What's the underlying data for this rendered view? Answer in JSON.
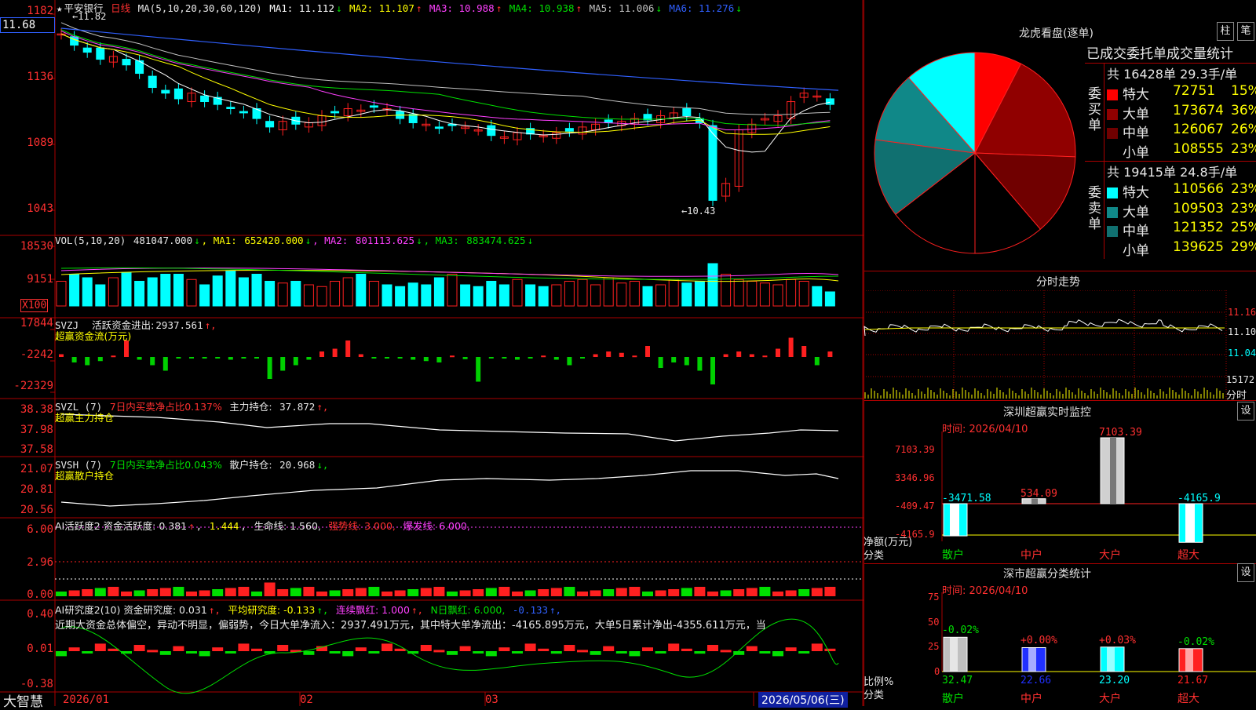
{
  "stock": {
    "name": "平安银行",
    "period": "日线",
    "current_price_tag": "11.68"
  },
  "kline": {
    "ma_header": "MA(5,10,20,30,60,120)",
    "ma_values": [
      {
        "label": "MA1:",
        "value": "11.112",
        "arrow": "↓",
        "color": "#ffffff"
      },
      {
        "label": "MA2:",
        "value": "11.107",
        "arrow": "↑",
        "color": "#ffff00"
      },
      {
        "label": "MA3:",
        "value": "10.988",
        "arrow": "↑",
        "color": "#ff40ff"
      },
      {
        "label": "MA4:",
        "value": "10.938",
        "arrow": "↑",
        "color": "#00e000"
      },
      {
        "label": "MA5:",
        "value": "11.006",
        "arrow": "↓",
        "color": "#c0c0c0"
      },
      {
        "label": "MA6:",
        "value": "11.276",
        "arrow": "↓",
        "color": "#3060ff"
      }
    ],
    "y_labels": [
      "1182",
      "1136",
      "1089",
      "1043"
    ],
    "high_note": "11.82",
    "low_note": "10.43"
  },
  "volume": {
    "header": "VOL(5,10,20)",
    "value": "481047.000",
    "ma1": "652420.000",
    "ma2": "801113.625",
    "ma3": "883474.625",
    "y_labels": [
      "18530",
      "9151"
    ],
    "unit": "X100"
  },
  "svzj": {
    "name": "SVZJ",
    "label": "活跃资金进出:",
    "value": "2937.561",
    "sub": "超赢资金流(万元)",
    "y_labels": [
      "17844",
      "-2242",
      "-22329"
    ]
  },
  "svzl": {
    "name": "SVZL (7)",
    "ratio_label": "7日内买卖净占比0.137%",
    "hold_label": "主力持仓:",
    "hold_value": "37.872",
    "sub": "超赢主力持仓",
    "y_labels": [
      "38.38",
      "37.98",
      "37.58"
    ]
  },
  "svsh": {
    "name": "SVSH (7)",
    "ratio_label": "7日内买卖净占比0.043%",
    "hold_label": "散户持仓:",
    "hold_value": "20.968",
    "sub": "超赢散户持仓",
    "y_labels": [
      "21.07",
      "20.81",
      "20.56"
    ]
  },
  "ai_active": {
    "header": "AI活跃度2 资金活跃度: 0.381",
    "v2": "1.444",
    "life": "生命线: 1.560,",
    "strong": "强势线: 3.000,",
    "burst": "爆发线: 6.000,",
    "y_labels": [
      "6.00",
      "2.96",
      "0.00"
    ]
  },
  "ai_research": {
    "header": "AI研究度2(10) 资金研究度: 0.031",
    "avg": "平均研究度: -0.133",
    "streak": "连续飘红: 1.000",
    "nday": "N日飘红: 6.000,",
    "last": "-0.133",
    "comment": "近期大资金总体偏空，异动不明显，偏弱势，今日大单净流入：2937.491万元，其中特大单净流出：-4165.895万元，大单5日累计净出-4355.611万元，当",
    "y_labels": [
      "0.40",
      "0.01",
      "-0.38"
    ]
  },
  "bottom_axis": {
    "brand": "大智慧",
    "labels": [
      "2026/01",
      "02",
      "03"
    ],
    "current_date": "2026/05/06(三)"
  },
  "longhu": {
    "title": "龙虎看盘(逐单)",
    "btn1": "柱",
    "btn2": "笔",
    "stat_title": "已成交委托单成交量统计",
    "buy_summary": "共 16428单 29.3手/单",
    "buy_side": [
      "委",
      "买",
      "单"
    ],
    "buy_rows": [
      {
        "label": "特大",
        "value": "72751",
        "pct": "15%",
        "color": "#ff0000"
      },
      {
        "label": "大单",
        "value": "173674",
        "pct": "36%",
        "color": "#900000"
      },
      {
        "label": "中单",
        "value": "126067",
        "pct": "26%",
        "color": "#700000"
      },
      {
        "label": "小单",
        "value": "108555",
        "pct": "23%",
        "color": "#000000"
      }
    ],
    "sell_summary": "共 19415单 24.8手/单",
    "sell_side": [
      "委",
      "卖",
      "单"
    ],
    "sell_rows": [
      {
        "label": "特大",
        "value": "110566",
        "pct": "23%",
        "color": "#00ffff"
      },
      {
        "label": "大单",
        "value": "109503",
        "pct": "23%",
        "color": "#108888"
      },
      {
        "label": "中单",
        "value": "121352",
        "pct": "25%",
        "color": "#107070"
      },
      {
        "label": "小单",
        "value": "139625",
        "pct": "29%",
        "color": "#000000"
      }
    ]
  },
  "intraday": {
    "title": "分时走势",
    "prices": [
      "11.16",
      "11.10",
      "11.04"
    ],
    "vol": "15172",
    "vol_label": "分时"
  },
  "monitor": {
    "title": "深圳超赢实时监控",
    "btn": "设",
    "time": "时间: 2026/04/10",
    "y_labels": [
      "7103.39",
      "3346.96",
      "-409.47",
      "-4165.9"
    ],
    "net_label": "净额(万元)",
    "cat_label": "分类",
    "bars": [
      {
        "cat": "散户",
        "value": "-3471.58"
      },
      {
        "cat": "中户",
        "value": "534.09"
      },
      {
        "cat": "大户",
        "value": "7103.39"
      },
      {
        "cat": "超大",
        "value": "-4165.9"
      }
    ]
  },
  "classify": {
    "title": "深市超赢分类统计",
    "btn": "设",
    "time": "时间: 2026/04/10",
    "y_labels": [
      "75",
      "50",
      "25",
      "0"
    ],
    "ratio_label": "比例%",
    "cat_label": "分类",
    "bars": [
      {
        "cat": "散户",
        "value": "32.47",
        "delta": "-0.02%"
      },
      {
        "cat": "中户",
        "value": "22.66",
        "delta": "+0.00%"
      },
      {
        "cat": "大户",
        "value": "23.20",
        "delta": "+0.03%"
      },
      {
        "cat": "超大",
        "value": "21.67",
        "delta": "-0.02%"
      }
    ]
  }
}
